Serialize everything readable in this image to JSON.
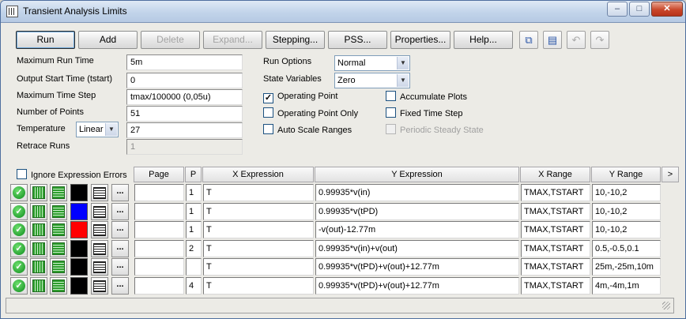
{
  "window": {
    "title": "Transient Analysis Limits",
    "caption_buttons": {
      "minimize": "–",
      "maximize": "□",
      "close": "✕"
    }
  },
  "toolbar": {
    "run": "Run",
    "add": "Add",
    "delete": "Delete",
    "expand": "Expand...",
    "stepping": "Stepping...",
    "pss": "PSS...",
    "properties": "Properties...",
    "help": "Help...",
    "icons": [
      "copy-icon",
      "paste-icon",
      "undo-icon",
      "redo-icon"
    ]
  },
  "fields": {
    "max_run_time": {
      "label": "Maximum Run Time",
      "value": "5m"
    },
    "output_start": {
      "label": "Output Start Time (tstart)",
      "value": "0"
    },
    "max_time_step": {
      "label": "Maximum Time Step",
      "value": "tmax/100000   (0,05u)"
    },
    "num_points": {
      "label": "Number of Points",
      "value": "51"
    },
    "temperature": {
      "label": "Temperature",
      "mode": "Linear",
      "value": "27"
    },
    "retrace_runs": {
      "label": "Retrace Runs",
      "value": "1"
    }
  },
  "options": {
    "run_options": {
      "label": "Run Options",
      "value": "Normal"
    },
    "state_variables": {
      "label": "State Variables",
      "value": "Zero"
    },
    "checks": [
      {
        "label": "Operating Point",
        "checked": true,
        "enabled": true
      },
      {
        "label": "Operating Point Only",
        "checked": false,
        "enabled": true
      },
      {
        "label": "Auto Scale Ranges",
        "checked": false,
        "enabled": true
      },
      {
        "label": "Accumulate Plots",
        "checked": false,
        "enabled": true
      },
      {
        "label": "Fixed Time Step",
        "checked": false,
        "enabled": true
      },
      {
        "label": "Periodic Steady State",
        "checked": false,
        "enabled": false
      }
    ]
  },
  "table": {
    "ignore_errors": {
      "label": "Ignore Expression Errors",
      "checked": false
    },
    "headers": {
      "page": "Page",
      "p": "P",
      "x_expr": "X Expression",
      "y_expr": "Y Expression",
      "x_range": "X Range",
      "y_range": "Y Range",
      "more": ">"
    },
    "rows": [
      {
        "page": "",
        "p": "1",
        "x_expr": "T",
        "y_expr": "0.99935*v(in)",
        "x_range": "TMAX,TSTART",
        "y_range": "10,-10,2",
        "color": "#000000"
      },
      {
        "page": "",
        "p": "1",
        "x_expr": "T",
        "y_expr": "0.99935*v(tPD)",
        "x_range": "TMAX,TSTART",
        "y_range": "10,-10,2",
        "color": "#0000ff"
      },
      {
        "page": "",
        "p": "1",
        "x_expr": "T",
        "y_expr": "-v(out)-12.77m",
        "x_range": "TMAX,TSTART",
        "y_range": "10,-10,2",
        "color": "#ff0000"
      },
      {
        "page": "",
        "p": "2",
        "x_expr": "T",
        "y_expr": "0.99935*v(in)+v(out)",
        "x_range": "TMAX,TSTART",
        "y_range": "0.5,-0.5,0.1",
        "color": "#000000"
      },
      {
        "page": "",
        "p": "",
        "x_expr": "T",
        "y_expr": "0.99935*v(tPD)+v(out)+12.77m",
        "x_range": "TMAX,TSTART",
        "y_range": "25m,-25m,10m",
        "color": "#000000"
      },
      {
        "page": "",
        "p": "4",
        "x_expr": "T",
        "y_expr": "0.99935*v(tPD)+v(out)+12.77m",
        "x_range": "TMAX,TSTART",
        "y_range": "4m,-4m,1m",
        "color": "#000000"
      }
    ],
    "row_buttons": {
      "ok": "✓",
      "more": "..."
    }
  }
}
